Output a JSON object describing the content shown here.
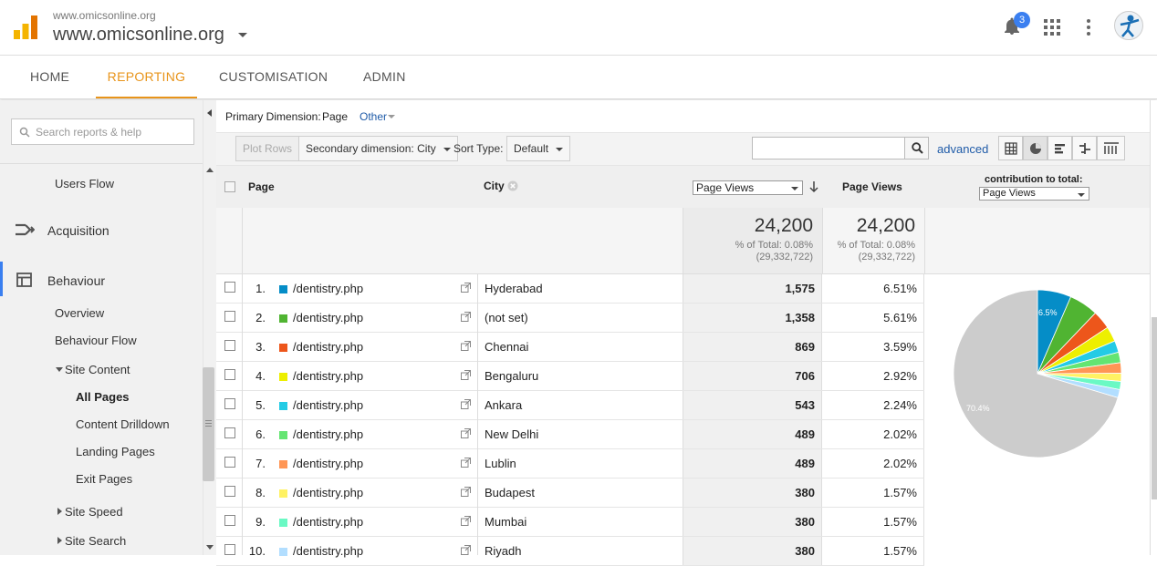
{
  "header": {
    "site_small": "www.omicsonline.org",
    "site_big": "www.omicsonline.org",
    "notification_count": "3"
  },
  "nav": {
    "tabs": [
      {
        "label": "HOME",
        "active": false
      },
      {
        "label": "REPORTING",
        "active": true
      },
      {
        "label": "CUSTOMISATION",
        "active": false
      },
      {
        "label": "ADMIN",
        "active": false
      }
    ]
  },
  "sidebar": {
    "search_placeholder": "Search reports & help",
    "users_flow": "Users Flow",
    "acquisition": "Acquisition",
    "behaviour": "Behaviour",
    "overview": "Overview",
    "behaviour_flow": "Behaviour Flow",
    "site_content": "Site Content",
    "all_pages": "All Pages",
    "content_drilldown": "Content Drilldown",
    "landing_pages": "Landing Pages",
    "exit_pages": "Exit Pages",
    "site_speed": "Site Speed",
    "site_search": "Site Search"
  },
  "report": {
    "primary_dimension_label": "Primary Dimension:",
    "primary_dimension_value": "Page",
    "other_label": "Other",
    "plot_rows": "Plot Rows",
    "secondary_dimension": "Secondary dimension: City",
    "sort_type_label": "Sort Type:",
    "sort_type_value": "Default",
    "advanced": "advanced"
  },
  "table": {
    "col_page": "Page",
    "col_city": "City",
    "metric_select": "Page Views",
    "col_pageviews": "Page Views",
    "contribution_label": "contribution to total:",
    "contribution_select": "Page Views",
    "summary": {
      "total1": "24,200",
      "pct1": "% of Total: 0.08%",
      "all1": "(29,332,722)",
      "total2": "24,200",
      "pct2": "% of Total: 0.08%",
      "all2": "(29,332,722)"
    },
    "rows": [
      {
        "n": "1.",
        "page": "/dentistry.php",
        "city": "Hyderabad",
        "pv": "1,575",
        "pct": "6.51%",
        "color": "#058dc7"
      },
      {
        "n": "2.",
        "page": "/dentistry.php",
        "city": "(not set)",
        "pv": "1,358",
        "pct": "5.61%",
        "color": "#50b432"
      },
      {
        "n": "3.",
        "page": "/dentistry.php",
        "city": "Chennai",
        "pv": "869",
        "pct": "3.59%",
        "color": "#ed561b"
      },
      {
        "n": "4.",
        "page": "/dentistry.php",
        "city": "Bengaluru",
        "pv": "706",
        "pct": "2.92%",
        "color": "#edef00"
      },
      {
        "n": "5.",
        "page": "/dentistry.php",
        "city": "Ankara",
        "pv": "543",
        "pct": "2.24%",
        "color": "#24cbe5"
      },
      {
        "n": "6.",
        "page": "/dentistry.php",
        "city": "New Delhi",
        "pv": "489",
        "pct": "2.02%",
        "color": "#64e572"
      },
      {
        "n": "7.",
        "page": "/dentistry.php",
        "city": "Lublin",
        "pv": "489",
        "pct": "2.02%",
        "color": "#ff9655"
      },
      {
        "n": "8.",
        "page": "/dentistry.php",
        "city": "Budapest",
        "pv": "380",
        "pct": "1.57%",
        "color": "#fff263"
      },
      {
        "n": "9.",
        "page": "/dentistry.php",
        "city": "Mumbai",
        "pv": "380",
        "pct": "1.57%",
        "color": "#6af9c4"
      },
      {
        "n": "10.",
        "page": "/dentistry.php",
        "city": "Riyadh",
        "pv": "380",
        "pct": "1.57%",
        "color": "#b2deff"
      }
    ]
  },
  "chart_data": {
    "type": "pie",
    "slice_label_first": "6.5%",
    "slice_label_other": "70.4%",
    "values": [
      6.51,
      5.61,
      3.59,
      2.92,
      2.24,
      2.02,
      2.02,
      1.57,
      1.57,
      1.57,
      70.38
    ],
    "colors": [
      "#058dc7",
      "#50b432",
      "#ed561b",
      "#edef00",
      "#24cbe5",
      "#64e572",
      "#ff9655",
      "#fff263",
      "#6af9c4",
      "#b2deff",
      "#cccccc"
    ]
  }
}
